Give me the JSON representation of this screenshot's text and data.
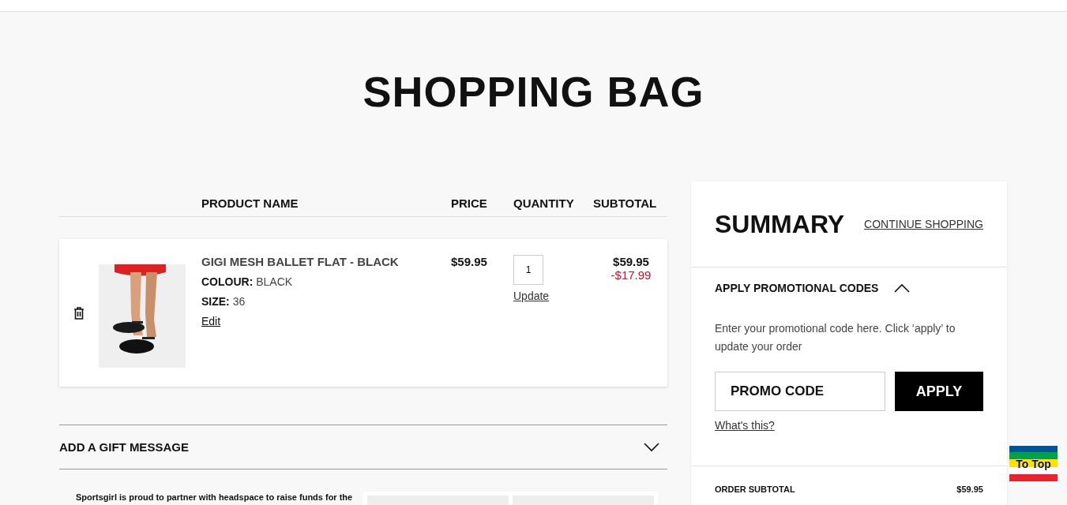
{
  "page_title": "SHOPPING BAG",
  "cart": {
    "columns": [
      "PRODUCT NAME",
      "PRICE",
      "QUANTITY",
      "SUBTOTAL"
    ],
    "items": [
      {
        "name": "GIGI MESH BALLET FLAT - BLACK",
        "attributes": [
          {
            "label": "COLOUR:",
            "value": "BLACK"
          },
          {
            "label": "SIZE:",
            "value": "36"
          }
        ],
        "edit_link": "Edit",
        "price": "$59.95",
        "quantity": "1",
        "update_link": "Update",
        "subtotal": "$59.95",
        "discount": "-$17.99"
      }
    ]
  },
  "gift_message": {
    "title": "ADD A GIFT MESSAGE",
    "expanded": false
  },
  "promo_banner": {
    "text": "Sportsgirl is proud to partner with headspace to raise funds for the"
  },
  "summary": {
    "title": "SUMMARY",
    "continue_link": "CONTINUE SHOPPING",
    "promo": {
      "title": "APPLY PROMOTIONAL CODES",
      "expanded": true,
      "description": "Enter your promotional code here. Click ‘apply’ to update your order",
      "placeholder": "PROMO CODE",
      "button": "APPLY",
      "help_link": "What's this?"
    },
    "totals": [
      {
        "label": "ORDER SUBTOTAL",
        "value": "$59.95"
      }
    ]
  },
  "to_top": "To Top"
}
